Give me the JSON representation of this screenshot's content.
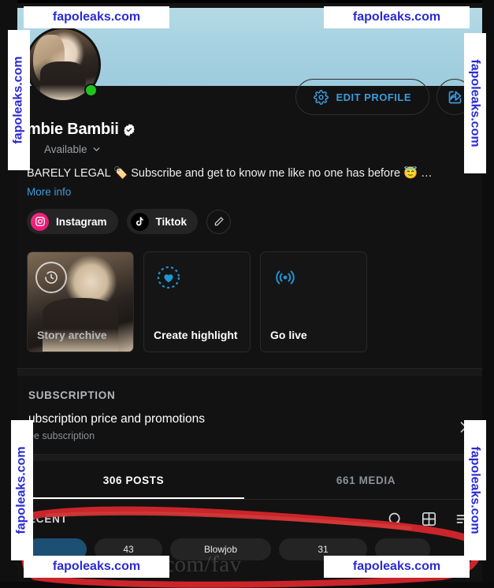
{
  "profile": {
    "display_name": "mbie Bambii",
    "verified_icon": "verified-badge-icon",
    "availability": "Available",
    "online_status_icon": "online-dot-icon",
    "bio": "BARELY LEGAL 🏷️ Subscribe and get to know me like no one has before 😇 …",
    "more_info_label": "More info",
    "banner_color": "#a6d1e1",
    "accent_color": "#3b9bdc"
  },
  "header_actions": {
    "edit_profile_label": "EDIT PROFILE",
    "gear_icon": "gear-icon",
    "share_icon": "share-icon"
  },
  "socials": [
    {
      "label": "Instagram",
      "icon": "instagram-icon",
      "color": "#ea1a78"
    },
    {
      "label": "Tiktok",
      "icon": "tiktok-icon",
      "color": "#000000"
    }
  ],
  "socials_edit_icon": "pencil-icon",
  "tiles": [
    {
      "label": "Story archive",
      "icon": "story-archive-clock-icon"
    },
    {
      "label": "Create highlight",
      "icon": "highlight-heart-icon"
    },
    {
      "label": "Go live",
      "icon": "broadcast-icon"
    }
  ],
  "subscription": {
    "section_title": "SUBSCRIPTION",
    "row_title": "ubscription price and promotions",
    "row_subtitle": "ee subscription",
    "chevron_icon": "chevron-right-icon"
  },
  "tabs": [
    {
      "label": "306 POSTS",
      "active": true
    },
    {
      "label": "661 MEDIA",
      "active": false
    }
  ],
  "content_toolbar": {
    "section_label": "ECENT",
    "search_icon": "search-icon",
    "grid_icon": "grid-view-icon",
    "sort_icon": "sort-icon"
  },
  "filter_pills": [
    {
      "label": "",
      "selected": true
    },
    {
      "label": "43",
      "selected": false
    },
    {
      "label": "Blowjob",
      "selected": false
    },
    {
      "label": "31",
      "selected": false
    },
    {
      "label": "",
      "selected": false
    }
  ],
  "overlays": {
    "site_watermark": "fapoleaks.com",
    "ghost_text": "lyFans.com/fav",
    "scribble_color": "#c9252a"
  }
}
